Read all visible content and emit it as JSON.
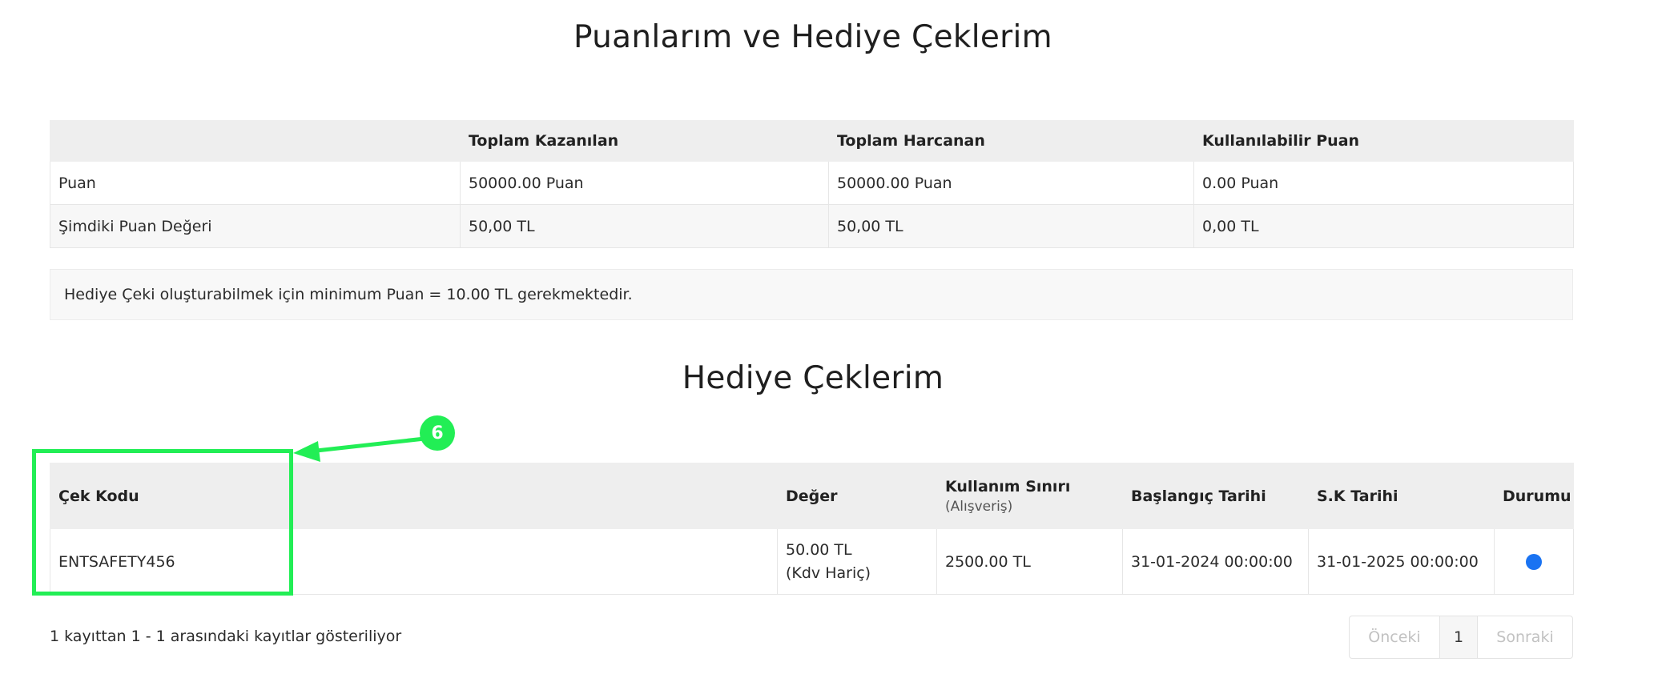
{
  "page_title": "Puanlarım ve Hediye Çeklerim",
  "points_table": {
    "headers": [
      "",
      "Toplam Kazanılan",
      "Toplam Harcanan",
      "Kullanılabilir Puan"
    ],
    "rows": [
      [
        "Puan",
        "50000.00 Puan",
        "50000.00 Puan",
        "0.00 Puan"
      ],
      [
        "Şimdiki Puan Değeri",
        "50,00 TL",
        "50,00 TL",
        "0,00 TL"
      ]
    ]
  },
  "info_message": "Hediye Çeki oluşturabilmek için minimum Puan = 10.00 TL gerekmektedir.",
  "vouchers_title": "Hediye Çeklerim",
  "vouchers_table": {
    "headers": {
      "code": "Çek Kodu",
      "value": "Değer",
      "limit": "Kullanım Sınırı",
      "limit_sub": "(Alışveriş)",
      "start": "Başlangıç Tarihi",
      "end": "S.K Tarihi",
      "status": "Durumu"
    },
    "rows": [
      {
        "code": "ENTSAFETY456",
        "value": "50.00 TL",
        "value_note": "(Kdv Hariç)",
        "limit": "2500.00 TL",
        "start": "31-01-2024 00:00:00",
        "end": "31-01-2025 00:00:00",
        "status_color": "#1a73f2"
      }
    ]
  },
  "records_info": "1 kayıttan 1 - 1 arasındaki kayıtlar gösteriliyor",
  "pagination": {
    "prev": "Önceki",
    "current": "1",
    "next": "Sonraki"
  },
  "annotation": {
    "badge": "6",
    "color": "#22ee55"
  }
}
